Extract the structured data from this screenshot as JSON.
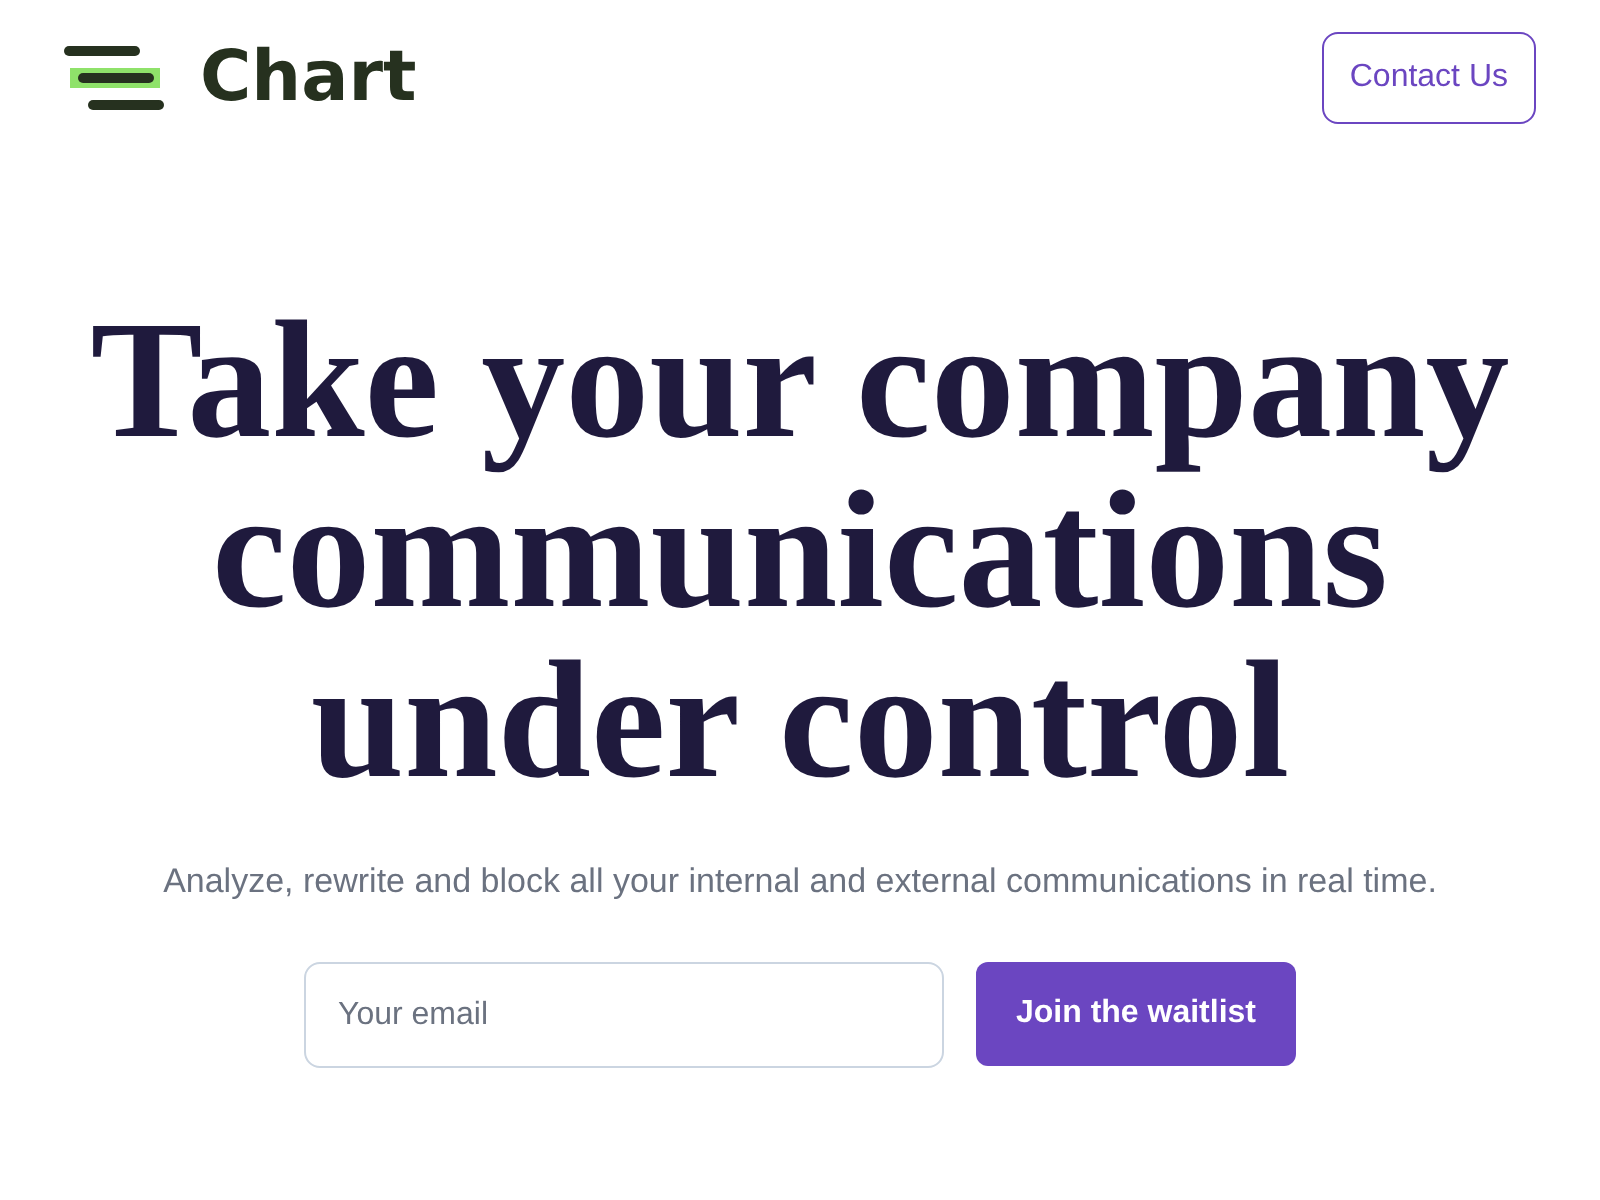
{
  "header": {
    "logo_text": "Chart",
    "contact_button": "Contact Us"
  },
  "hero": {
    "heading": "Take your company communications under control",
    "subtitle": "Analyze, rewrite and block all your internal and external communications in real time.",
    "email_field": {
      "placeholder": "Your email"
    },
    "submit_button": "Join the waitlist"
  }
}
